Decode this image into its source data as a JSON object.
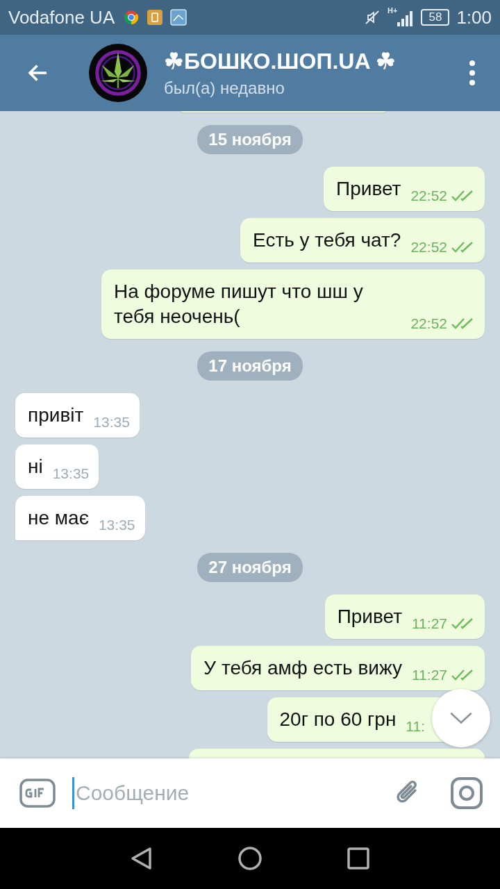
{
  "status_bar": {
    "carrier": "Vodafone UA",
    "network": "H+",
    "battery": "58",
    "time": "1:00"
  },
  "header": {
    "title": "☘БОШКО.ШОП.UA ☘",
    "subtitle": "был(а) недавно"
  },
  "messages": [
    {
      "kind": "cut"
    },
    {
      "kind": "date",
      "text": "15 ноября"
    },
    {
      "kind": "out",
      "text": "Привет",
      "time": "22:52",
      "read": true
    },
    {
      "kind": "out",
      "text": "Есть у тебя чат?",
      "time": "22:52",
      "read": true
    },
    {
      "kind": "out",
      "text": "На форуме пишут что шш у тебя неочень(",
      "time": "22:52",
      "read": true
    },
    {
      "kind": "date",
      "text": "17 ноября"
    },
    {
      "kind": "in",
      "text": "привіт",
      "time": "13:35"
    },
    {
      "kind": "in",
      "text": "ні",
      "time": "13:35"
    },
    {
      "kind": "in",
      "text": "не має",
      "time": "13:35",
      "tail": true
    },
    {
      "kind": "date",
      "text": "27 ноября"
    },
    {
      "kind": "out",
      "text": "Привет",
      "time": "11:27",
      "read": true
    },
    {
      "kind": "out",
      "text": "У тебя амф есть вижу",
      "time": "11:27",
      "read": true
    },
    {
      "kind": "out",
      "text": "20г по 60 грн",
      "time": "11:"
    },
    {
      "kind": "out-cut"
    }
  ],
  "composer": {
    "placeholder": "Сообщение"
  }
}
